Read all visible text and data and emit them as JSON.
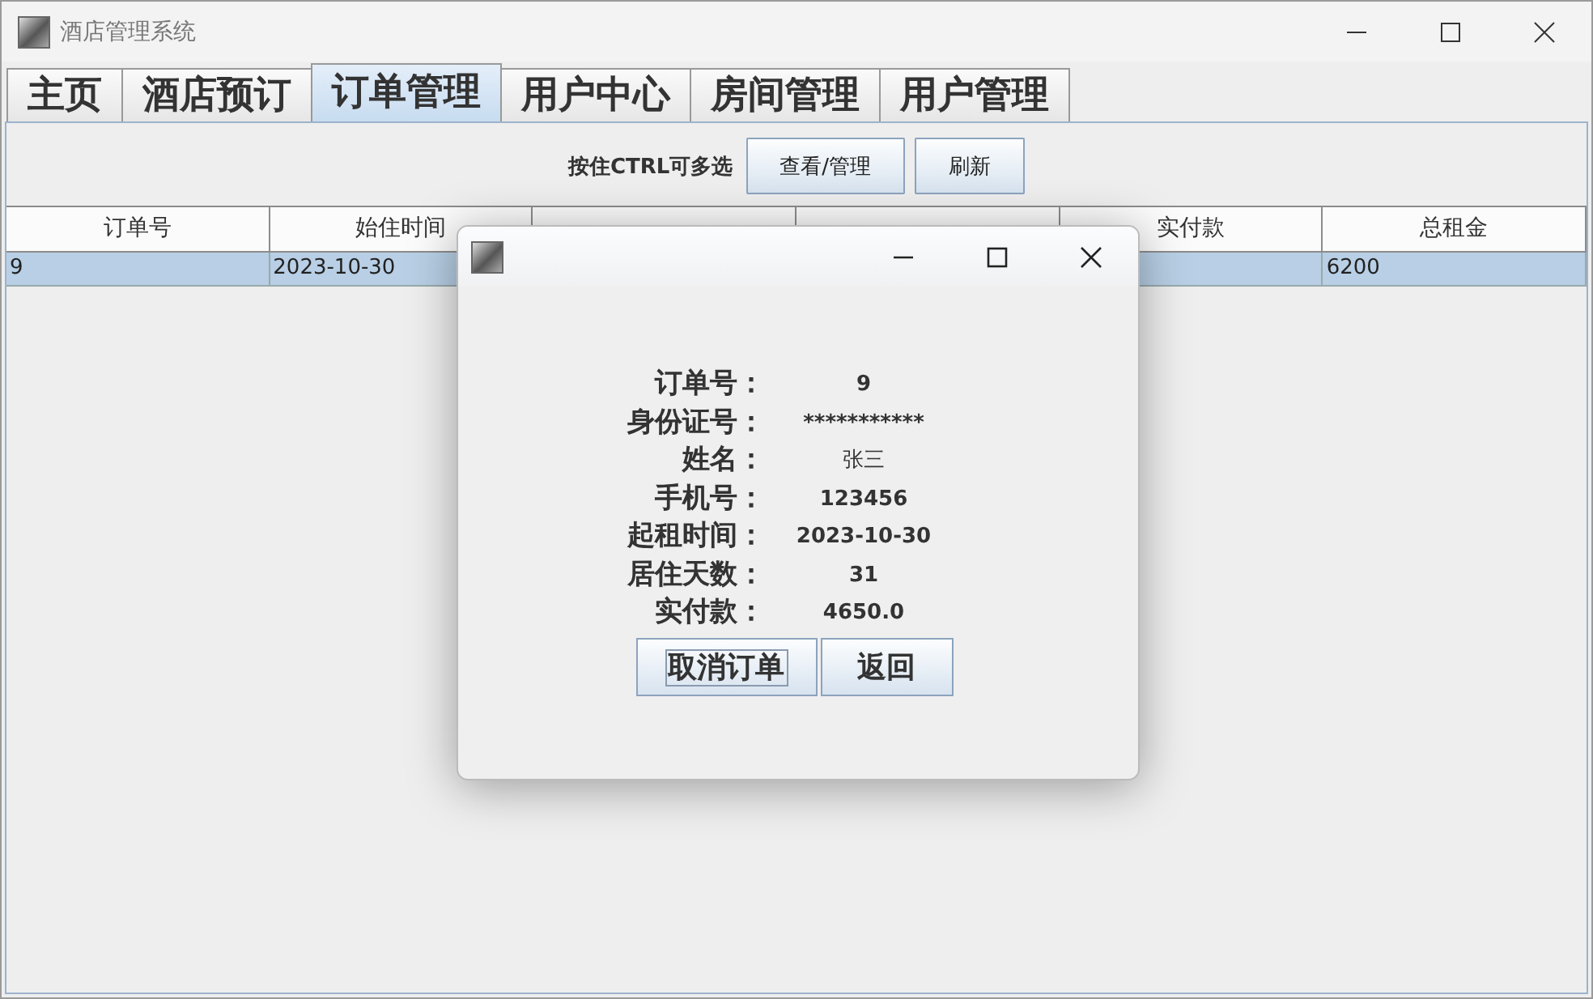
{
  "window": {
    "title": "酒店管理系统"
  },
  "tabs": [
    {
      "label": "主页",
      "selected": false
    },
    {
      "label": "酒店预订",
      "selected": false
    },
    {
      "label": "订单管理",
      "selected": true
    },
    {
      "label": "用户中心",
      "selected": false
    },
    {
      "label": "房间管理",
      "selected": false
    },
    {
      "label": "用户管理",
      "selected": false
    }
  ],
  "toolbar": {
    "hint": "按住CTRL可多选",
    "buttons": [
      "查看/管理",
      "刷新"
    ]
  },
  "table": {
    "columns": [
      {
        "label": "订单号"
      },
      {
        "label": "始住时间"
      },
      {},
      {},
      {
        "label": "实付款"
      },
      {
        "label": "总租金"
      }
    ],
    "rows": [
      {
        "selected": true,
        "cells": [
          "9",
          "2023-10-30",
          null,
          null,
          null,
          "6200"
        ]
      }
    ]
  },
  "dialog": {
    "fields": [
      {
        "label": "订单号：",
        "value": "9"
      },
      {
        "label": "身份证号：",
        "value": "***********"
      },
      {
        "label": "姓名：",
        "value": "张三",
        "plain": true
      },
      {
        "label": "手机号：",
        "value": "123456"
      },
      {
        "label": "起租时间：",
        "value": "2023-10-30"
      },
      {
        "label": "居住天数：",
        "value": "31"
      },
      {
        "label": "实付款：",
        "value": "4650.0"
      }
    ],
    "buttons": [
      {
        "label": "取消订单",
        "focused": true
      },
      {
        "label": "返回",
        "focused": false
      }
    ]
  }
}
